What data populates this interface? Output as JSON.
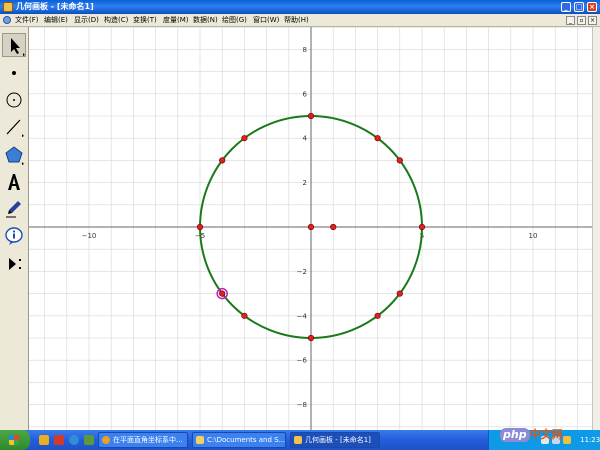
{
  "window": {
    "title": "几何画板 - [未命名1]",
    "buttons": [
      "minimize",
      "maximize",
      "close"
    ]
  },
  "menubar": {
    "items": [
      "文件(F)",
      "编辑(E)",
      "显示(D)",
      "构造(C)",
      "变换(T)",
      "度量(M)",
      "数据(N)",
      "绘图(G)",
      "窗口(W)",
      "帮助(H)"
    ]
  },
  "toolbox": {
    "tools": [
      "arrow-select-tool",
      "point-tool",
      "compass-tool",
      "straightedge-tool",
      "polygon-tool",
      "text-tool",
      "marker-tool",
      "information-tool",
      "custom-tool"
    ]
  },
  "graph": {
    "x_tick_labels": [
      "−10",
      "−5",
      "5",
      "10"
    ],
    "y_tick_labels": [
      "8",
      "6",
      "4",
      "2",
      "−2",
      "−4",
      "−6",
      "−8"
    ],
    "circle": {
      "center": [
        0,
        0
      ],
      "radius": 5,
      "color": "#1a7a1a"
    },
    "points": [
      [
        0,
        5
      ],
      [
        3,
        4
      ],
      [
        4,
        3
      ],
      [
        5,
        0
      ],
      [
        4,
        -3
      ],
      [
        3,
        -4
      ],
      [
        0,
        -5
      ],
      [
        -3,
        -4
      ],
      [
        -4,
        -3
      ],
      [
        -5,
        0
      ],
      [
        -4,
        3
      ],
      [
        -3,
        4
      ],
      [
        0,
        0
      ],
      [
        1,
        0
      ]
    ],
    "selected_point": [
      -4,
      -3
    ],
    "point_color": "#e02020",
    "selection_color": "#c020c0"
  },
  "taskbar": {
    "tasks": [
      {
        "label": "在平面直角坐标系中...",
        "icon": "firefox-icon"
      },
      {
        "label": "C:\\Documents and S...",
        "icon": "folder-icon"
      },
      {
        "label": "几何画板 - [未命名1]",
        "icon": "sketchpad-icon"
      }
    ],
    "clock": "11:23"
  },
  "watermark": {
    "php": "php",
    "cn": "中文网"
  }
}
